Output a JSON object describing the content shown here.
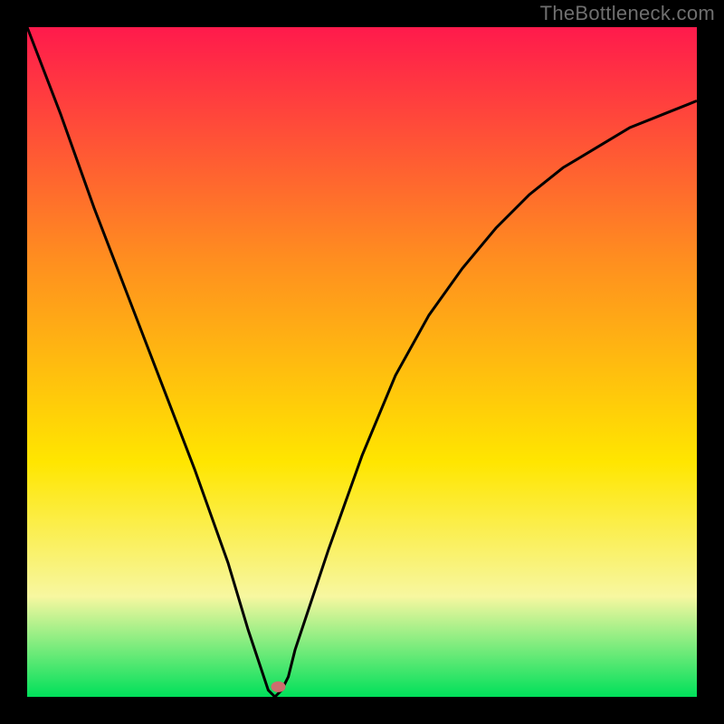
{
  "watermark": "TheBottleneck.com",
  "chart_data": {
    "type": "line",
    "title": "",
    "xlabel": "",
    "ylabel": "",
    "xlim": [
      0,
      100
    ],
    "ylim": [
      0,
      100
    ],
    "x": [
      0,
      5,
      10,
      15,
      20,
      25,
      30,
      33,
      35,
      36,
      37,
      38,
      39,
      40,
      45,
      50,
      55,
      60,
      65,
      70,
      75,
      80,
      85,
      90,
      95,
      100
    ],
    "values": [
      100,
      87,
      73,
      60,
      47,
      34,
      20,
      10,
      4,
      1,
      0,
      1,
      3,
      7,
      22,
      36,
      48,
      57,
      64,
      70,
      75,
      79,
      82,
      85,
      87,
      89
    ],
    "minimum_x": 37,
    "minimum_y": 0,
    "marker": {
      "x": 37.5,
      "y": 1.5
    },
    "grid": false,
    "legend": false,
    "colors": {
      "gradient_top": "#ff1a4c",
      "gradient_mid1": "#ff8f1f",
      "gradient_mid2": "#ffe600",
      "gradient_low": "#f7f7a0",
      "gradient_bottom": "#00e05a",
      "curve": "#000000",
      "marker": "#cc6e6e",
      "frame": "#000000"
    }
  }
}
